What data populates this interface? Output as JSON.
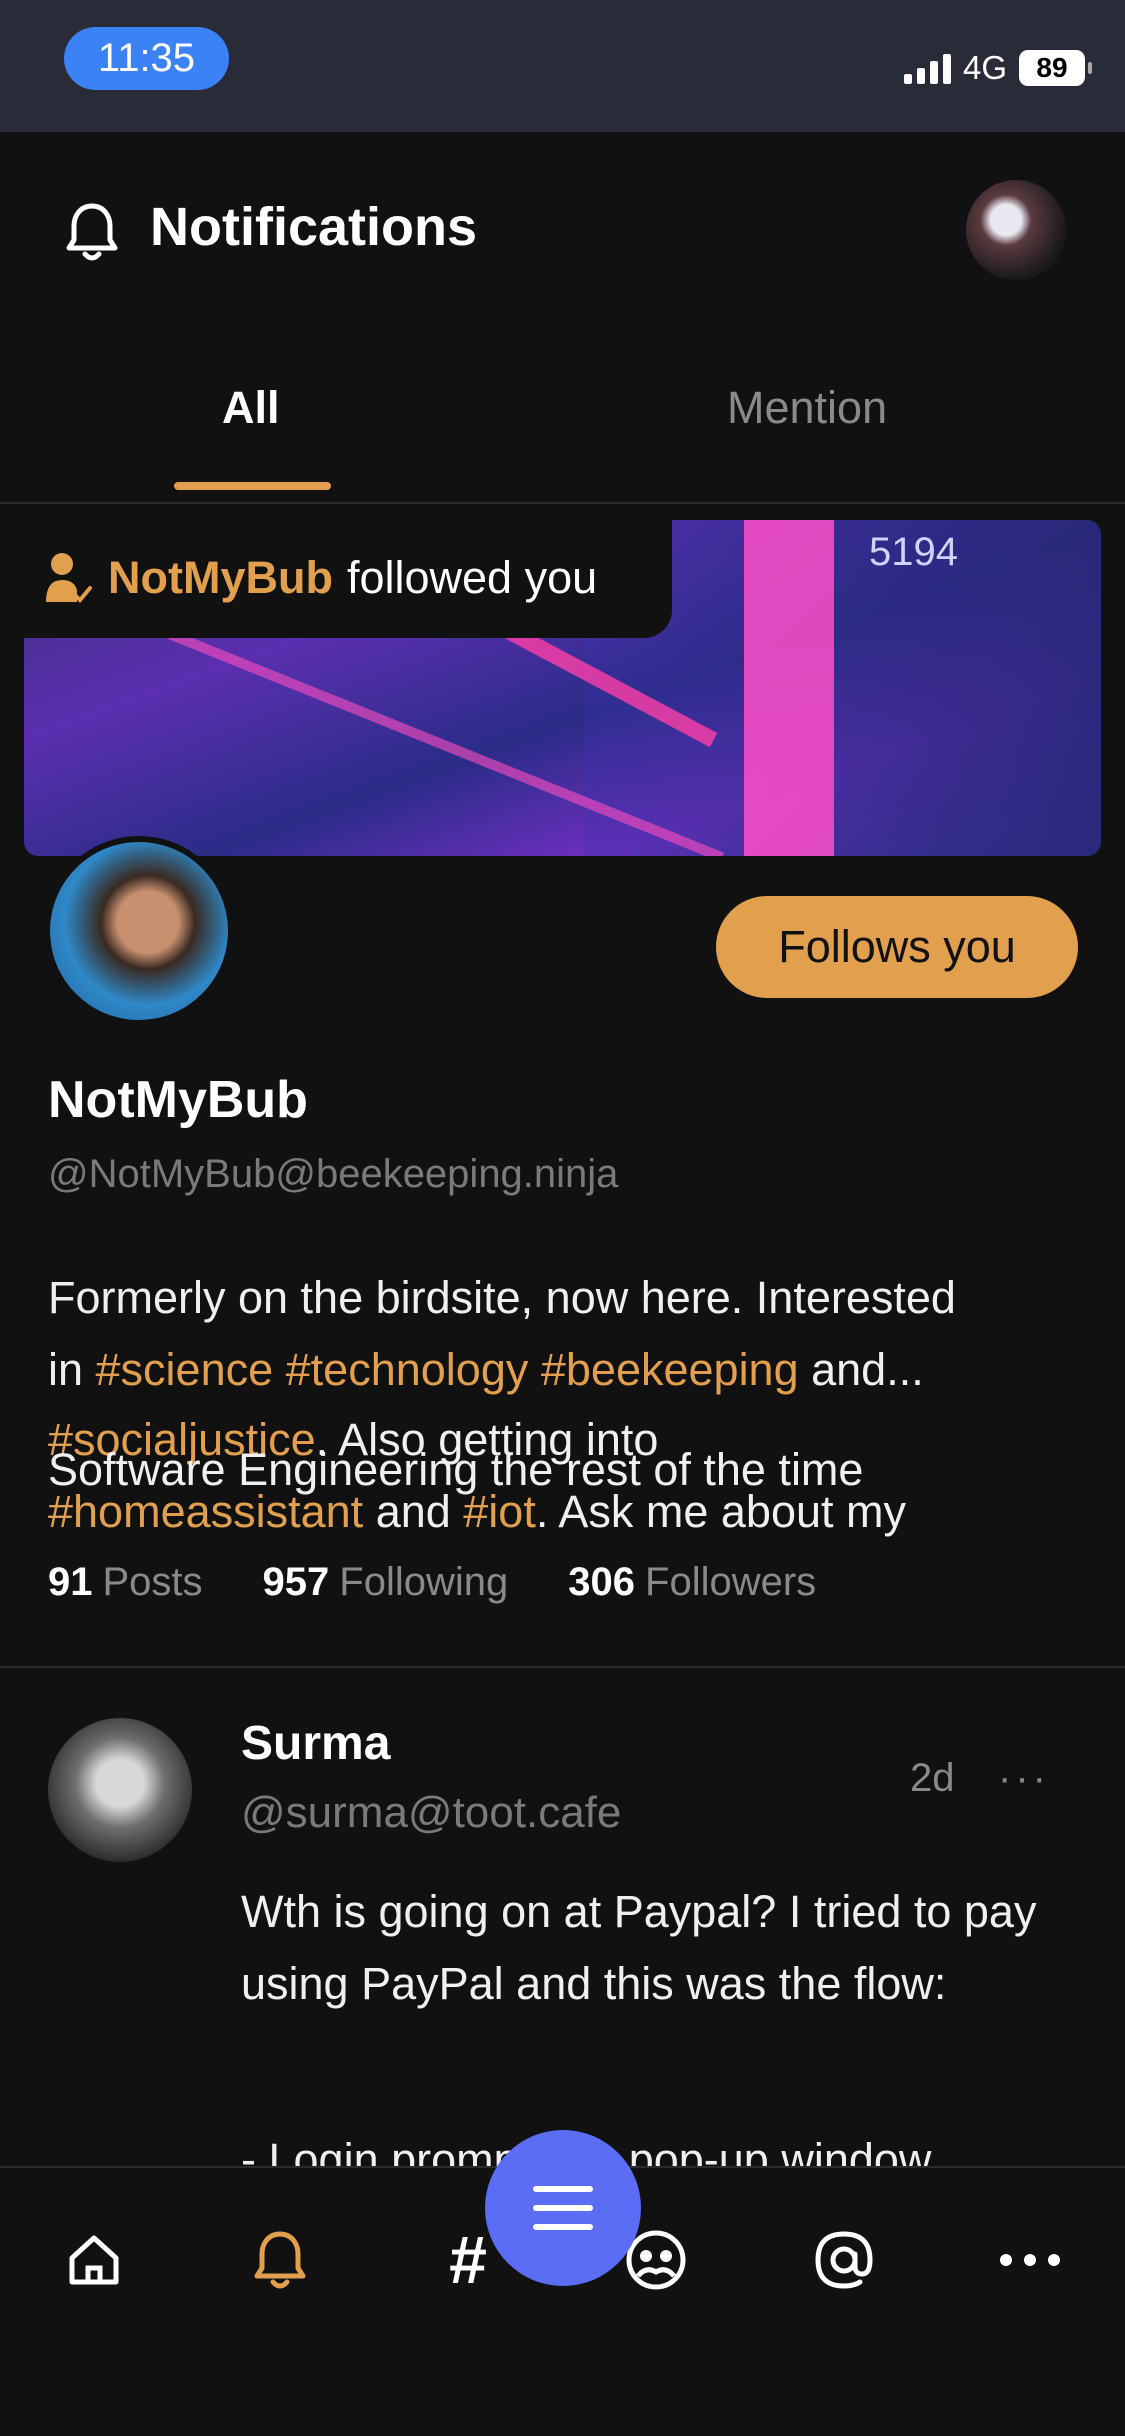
{
  "status_bar": {
    "time": "11:35",
    "network": "4G",
    "battery": "89"
  },
  "header": {
    "title": "Notifications"
  },
  "tabs": [
    {
      "label": "All"
    },
    {
      "label": "Mention"
    }
  ],
  "notification": {
    "actor": "NotMyBub",
    "action_text": "followed you",
    "banner_text": "5194",
    "follows_you_label": "Follows you",
    "profile": {
      "name": "NotMyBub",
      "handle": "@NotMyBub@beekeeping.ninja",
      "bio_line1": "Formerly on the birdsite, now here. Interested",
      "bio_line2_pre": "in ",
      "bio_tag1": "#science",
      "bio_tag2": "#technology",
      "bio_tag3": "#beekeeping",
      "bio_line2_post": " and...",
      "bio_tag4": "#socialjustice",
      "bio_line3_post": ". Also getting into",
      "bio_overlap": "Software Engineering the rest of the time",
      "bio_tag5": "#homeassistant",
      "bio_line4_mid": " and ",
      "bio_tag6": "#iot",
      "bio_line4_post": ". Ask me about my"
    },
    "stats": {
      "posts_count": "91",
      "posts_label": "Posts",
      "following_count": "957",
      "following_label": "Following",
      "followers_count": "306",
      "followers_label": "Followers"
    }
  },
  "post": {
    "author": "Surma",
    "handle": "@surma@toot.cafe",
    "time": "2d",
    "more": "···",
    "text": "Wth is going on at Paypal? I tried to pay using PayPal and this was the flow:",
    "text2": "- Login prompt in a pop-up window"
  },
  "bottom_nav": {
    "items": [
      "home-icon",
      "bell-icon",
      "hashtag-icon",
      "groups-icon",
      "at-icon",
      "more-icon"
    ],
    "hashtag": "#"
  },
  "colors": {
    "accent": "#e2a04e",
    "fab": "#5b6cf5",
    "status_pill": "#3b82f6",
    "background": "#111111"
  }
}
